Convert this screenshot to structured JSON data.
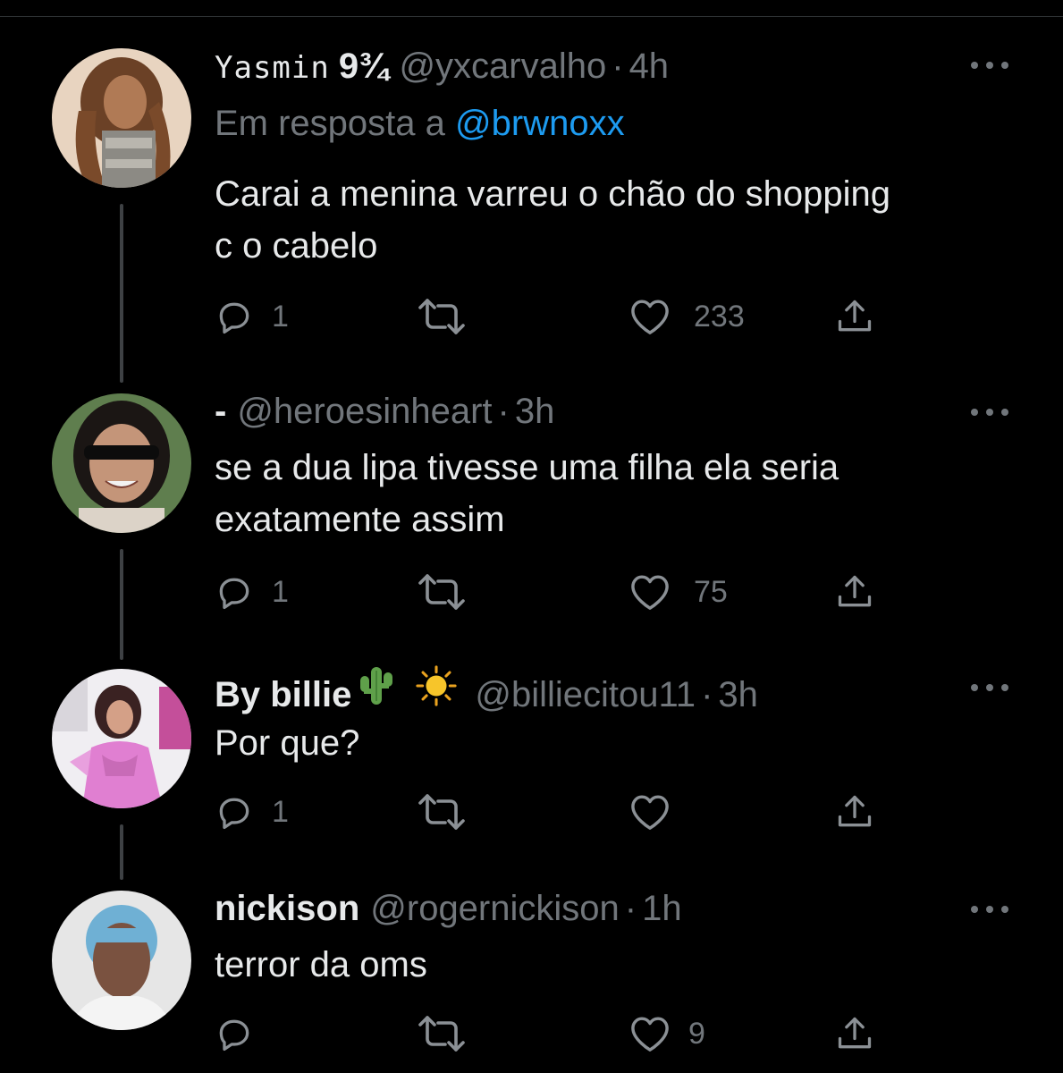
{
  "colors": {
    "background": "#000000",
    "text": "#e7e9ea",
    "secondary": "#71767b",
    "link": "#1d9bf0",
    "thread_line": "#3e4144"
  },
  "tweets": [
    {
      "name": "Yasmin",
      "name_extra": "9¾",
      "handle": "@yxcarvalho",
      "separator": "·",
      "time": "4h",
      "reply_prefix": "Em resposta a",
      "reply_mention": "@brwnoxx",
      "text_line1": "Carai a menina varreu o chão do shopping",
      "text_line2": "c o cabelo",
      "reply_count": "1",
      "retweet_count": "",
      "like_count": "233"
    },
    {
      "name": "-",
      "handle": "@heroesinheart",
      "separator": "·",
      "time": "3h",
      "text_line1": "se a dua lipa tivesse uma filha ela seria",
      "text_line2": "exatamente assim",
      "reply_count": "1",
      "retweet_count": "",
      "like_count": "75"
    },
    {
      "name": "By billie",
      "emoji_icons": [
        "cactus-icon",
        "sun-icon"
      ],
      "handle": "@billiecitou11",
      "separator": "·",
      "time": "3h",
      "text_line1": "Por que?",
      "reply_count": "1",
      "retweet_count": "",
      "like_count": ""
    },
    {
      "name": "nickison",
      "handle": "@rogernickison",
      "separator": "·",
      "time": "1h",
      "text_line1": "terror da oms",
      "reply_count": "",
      "retweet_count": "",
      "like_count": "9"
    }
  ]
}
